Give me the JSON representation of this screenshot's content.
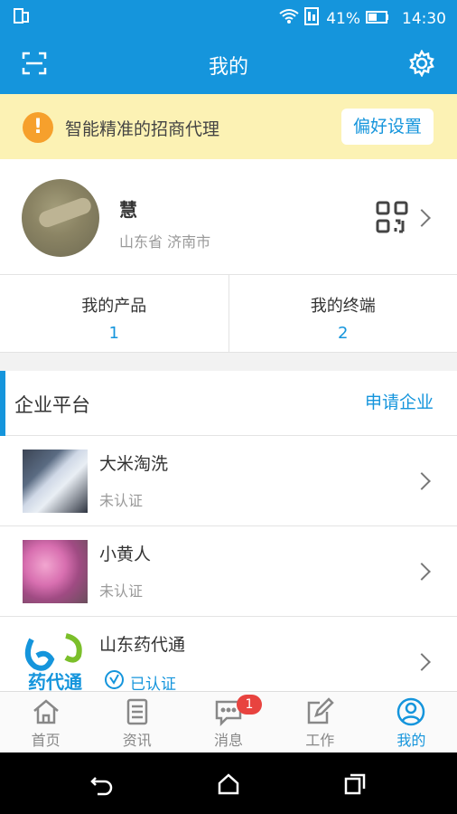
{
  "status": {
    "battery": "41%",
    "time": "14:30"
  },
  "header": {
    "title": "我的"
  },
  "notice": {
    "text": "智能精准的招商代理",
    "button": "偏好设置",
    "icon": "!"
  },
  "profile": {
    "name": "慧",
    "location": "山东省 济南市"
  },
  "stats": [
    {
      "label": "我的产品",
      "value": "1"
    },
    {
      "label": "我的终端",
      "value": "2"
    }
  ],
  "section": {
    "title": "企业平台",
    "action": "申请企业"
  },
  "companies": [
    {
      "name": "大米淘洗",
      "status": "未认证"
    },
    {
      "name": "小黄人",
      "status": "未认证"
    },
    {
      "name": "山东药代通",
      "status": "已认证"
    }
  ],
  "logo_text": "药代通",
  "tabs": [
    {
      "label": "首页"
    },
    {
      "label": "资讯"
    },
    {
      "label": "消息"
    },
    {
      "label": "工作"
    },
    {
      "label": "我的"
    }
  ],
  "badge": "1",
  "colors": {
    "primary": "#1595dc",
    "notice_bg": "#fcf2b4",
    "badge": "#e8433f"
  }
}
